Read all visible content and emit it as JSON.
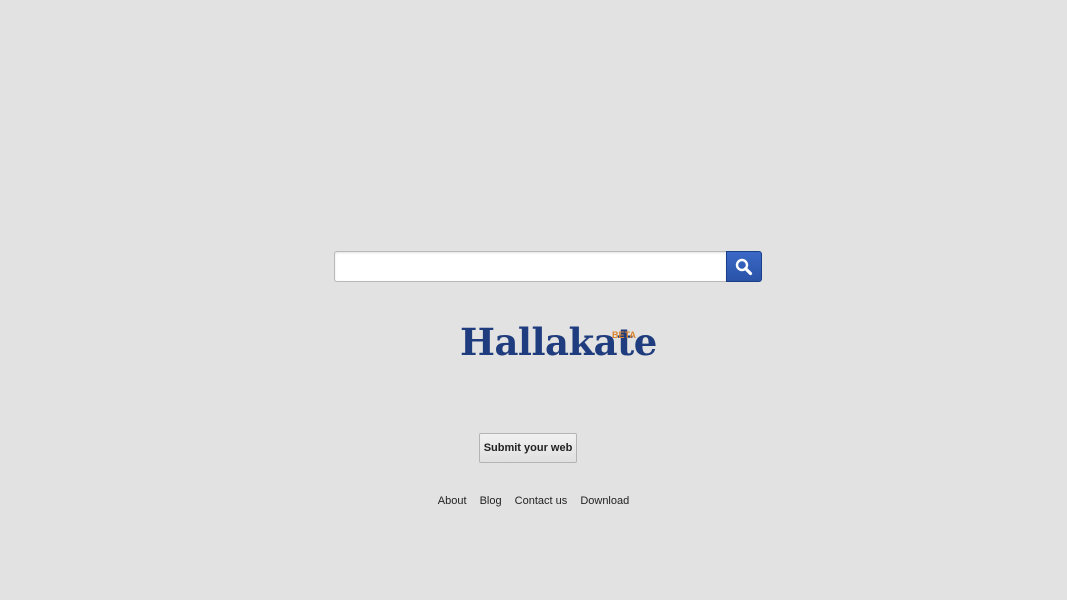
{
  "search": {
    "value": "",
    "placeholder": "",
    "button_icon": "search-icon",
    "button_color": "#2f5bb3"
  },
  "logo": {
    "name": "Hallakate",
    "badge": "BETA",
    "name_color": "#1f3c7e",
    "badge_color": "#d9822b"
  },
  "submit_button": {
    "label": "Submit your web"
  },
  "footer": {
    "links": [
      "About",
      "Blog",
      "Contact us",
      "Download"
    ]
  },
  "colors": {
    "background": "#e2e2e2"
  }
}
